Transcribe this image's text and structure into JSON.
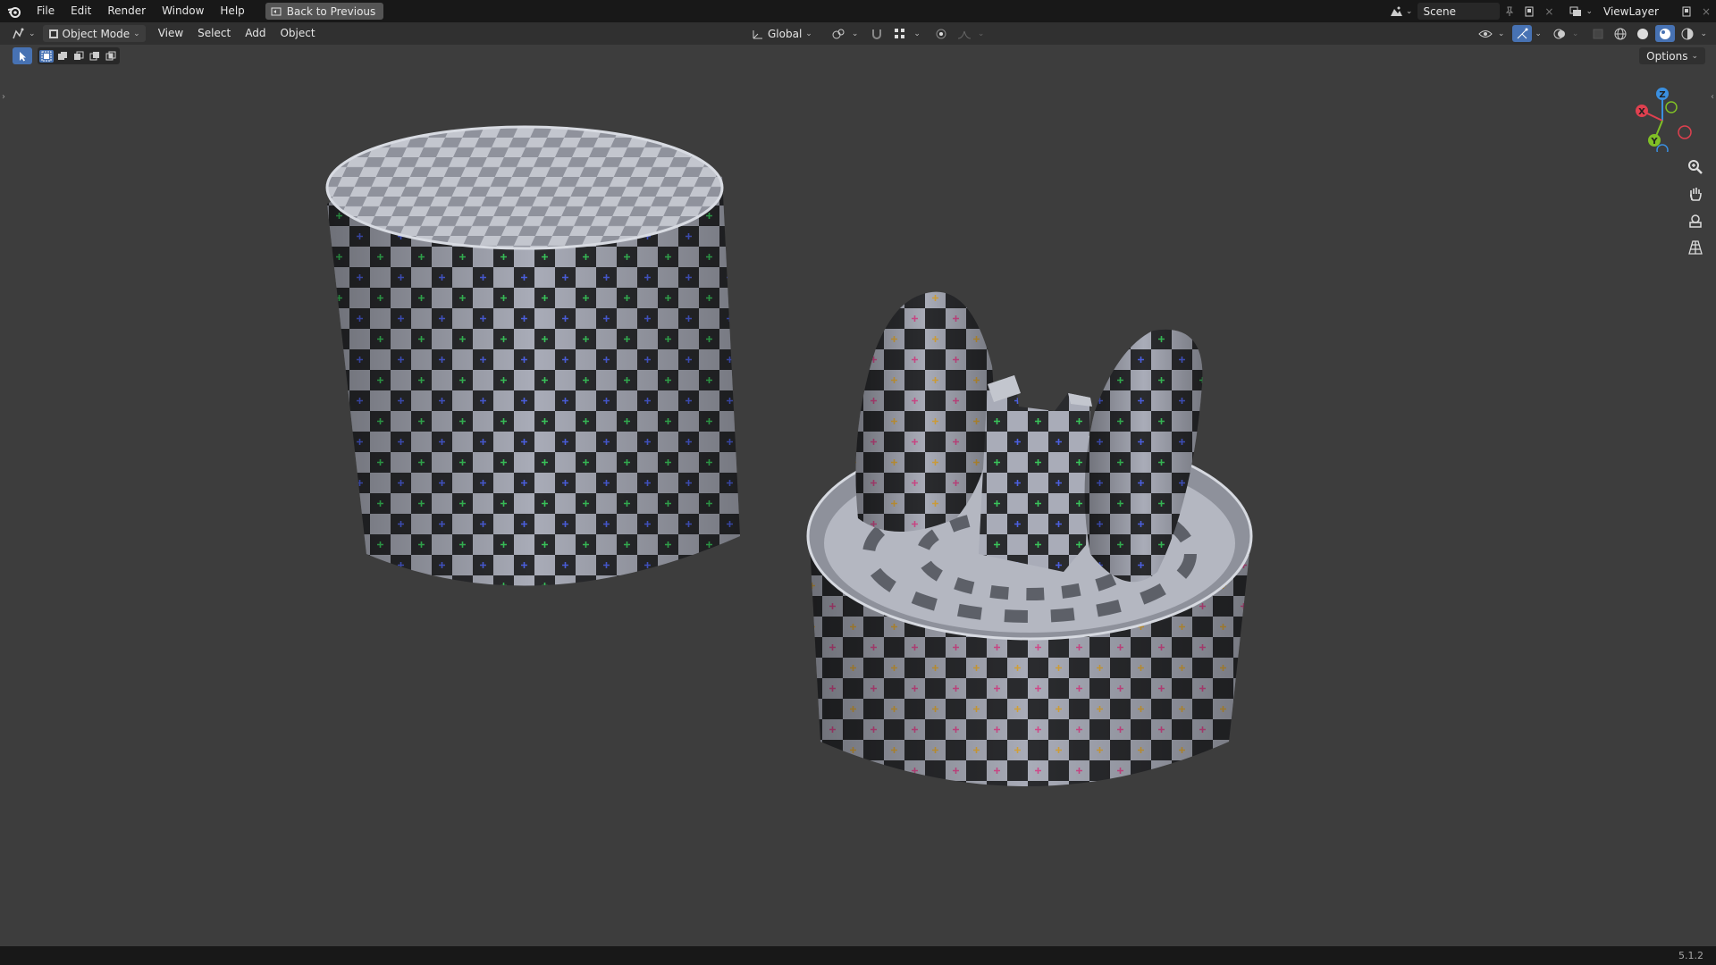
{
  "menu": {
    "file": "File",
    "edit": "Edit",
    "render": "Render",
    "window": "Window",
    "help": "Help",
    "back_button": "Back to Previous"
  },
  "top_right": {
    "scene": "Scene",
    "view_layer": "ViewLayer"
  },
  "header": {
    "mode": "Object Mode",
    "view": "View",
    "select": "Select",
    "add": "Add",
    "object": "Object",
    "transform_orientation": "Global"
  },
  "toolbar": {
    "options": "Options"
  },
  "gizmo": {
    "x": "X",
    "y": "Y",
    "z": "Z"
  },
  "status": {
    "version": "5.1.2"
  },
  "colors": {
    "axis_x": "#e0404f",
    "axis_y": "#80c026",
    "axis_z": "#3a8fe0",
    "checker_light": "#a9acb8",
    "checker_dark": "#2a2b2e"
  }
}
